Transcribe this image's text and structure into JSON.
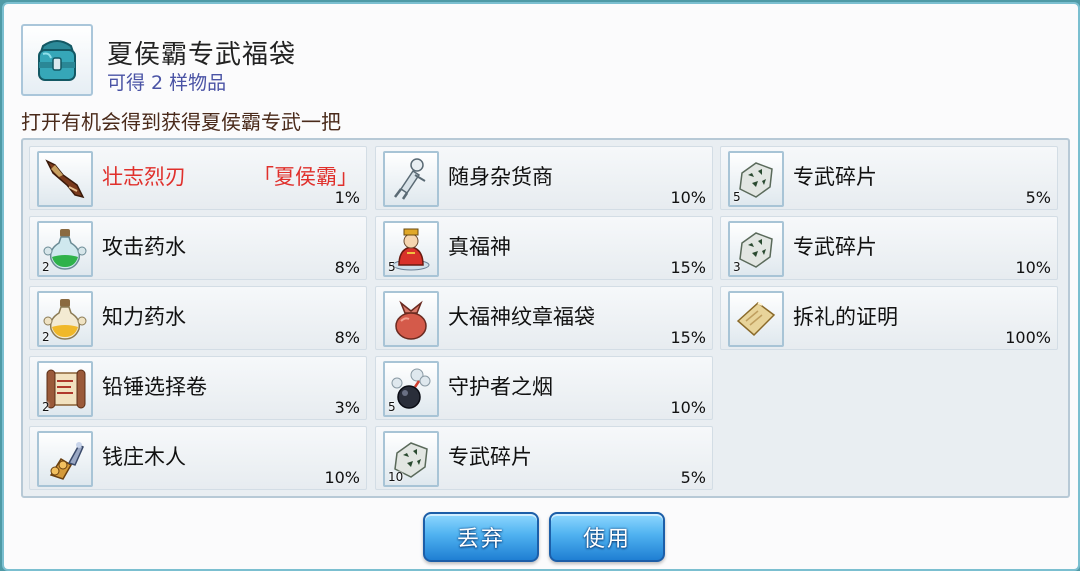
{
  "header": {
    "title": "夏侯霸专武福袋",
    "subtitle": "可得 2 样物品",
    "description": "打开有机会得到获得夏侯霸专武一把",
    "icon": "teal-bag-icon"
  },
  "items": [
    {
      "name": "壮志烈刃",
      "tag": "「夏侯霸」",
      "pct": "1%",
      "qty": "",
      "icon": "blade-icon",
      "highlight": true
    },
    {
      "name": "攻击药水",
      "tag": "",
      "pct": "8%",
      "qty": "2",
      "icon": "green-potion-icon"
    },
    {
      "name": "知力药水",
      "tag": "",
      "pct": "8%",
      "qty": "2",
      "icon": "yellow-potion-icon"
    },
    {
      "name": "铅锤选择卷",
      "tag": "",
      "pct": "3%",
      "qty": "2",
      "icon": "scroll-icon"
    },
    {
      "name": "钱庄木人",
      "tag": "",
      "pct": "10%",
      "qty": "",
      "icon": "wooden-figure-icon"
    },
    {
      "name": "随身杂货商",
      "tag": "",
      "pct": "10%",
      "qty": "",
      "icon": "merchant-doll-icon"
    },
    {
      "name": "真福神",
      "tag": "",
      "pct": "15%",
      "qty": "5",
      "icon": "fortune-god-icon"
    },
    {
      "name": "大福神纹章福袋",
      "tag": "",
      "pct": "15%",
      "qty": "",
      "icon": "red-pouch-icon"
    },
    {
      "name": "守护者之烟",
      "tag": "",
      "pct": "10%",
      "qty": "5",
      "icon": "smoke-bomb-icon"
    },
    {
      "name": "专武碎片",
      "tag": "",
      "pct": "5%",
      "qty": "10",
      "icon": "fragment-icon"
    },
    {
      "name": "专武碎片",
      "tag": "",
      "pct": "5%",
      "qty": "5",
      "icon": "fragment-icon"
    },
    {
      "name": "专武碎片",
      "tag": "",
      "pct": "10%",
      "qty": "3",
      "icon": "fragment-icon"
    },
    {
      "name": "拆礼的证明",
      "tag": "",
      "pct": "100%",
      "qty": "",
      "icon": "certificate-icon"
    }
  ],
  "buttons": {
    "discard": "丢弃",
    "use": "使用"
  },
  "colors": {
    "highlight_text": "#e0302c",
    "subtitle": "#4a53a5",
    "button_blue": "#1f7fd3"
  }
}
